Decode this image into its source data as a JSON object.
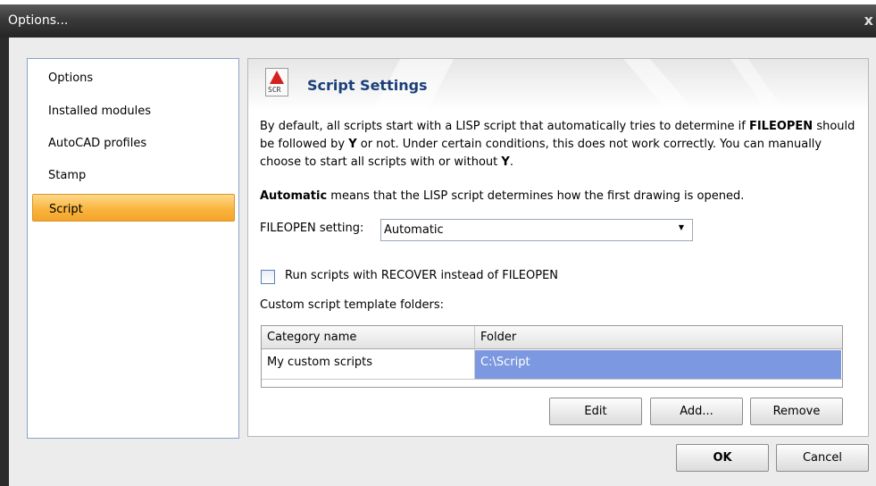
{
  "window": {
    "title": "Options...",
    "close_label": "x"
  },
  "nav": {
    "items": [
      {
        "label": "Options"
      },
      {
        "label": "Installed modules"
      },
      {
        "label": "AutoCAD profiles"
      },
      {
        "label": "Stamp"
      },
      {
        "label": "Script",
        "selected": true
      }
    ]
  },
  "panel": {
    "icon": "script-file-icon",
    "icon_text": "SCR",
    "heading": "Script Settings",
    "para1": {
      "t1": "By default, all scripts start with a LISP script that automatically tries to determine if ",
      "b1": "FILEOPEN",
      "t2": " should be followed by ",
      "b2": "Y",
      "t3": " or not. Under certain conditions, this does not work correctly. You can manually choose to start all scripts with or without ",
      "b3": "Y",
      "t4": "."
    },
    "para2": {
      "b1": "Automatic",
      "t1": " means that the LISP script determines how the first drawing is opened."
    },
    "fileopen": {
      "label": "FILEOPEN setting:",
      "value": "Automatic"
    },
    "recover_checkbox": {
      "label": "Run scripts with RECOVER instead of FILEOPEN",
      "checked": false
    },
    "folders_label": "Custom script template folders:",
    "table": {
      "columns": [
        "Category name",
        "Folder"
      ],
      "rows": [
        {
          "category": "My custom scripts",
          "folder": "C:\\Script"
        }
      ]
    },
    "buttons": {
      "edit": "Edit",
      "add": "Add...",
      "remove": "Remove"
    }
  },
  "footer": {
    "ok": "OK",
    "cancel": "Cancel"
  },
  "colors": {
    "title_bar": "#3a3a3a",
    "selection_orange": "#f9b53f",
    "heading_blue": "#1a3f7a",
    "grid_selection": "#7b98e0"
  }
}
